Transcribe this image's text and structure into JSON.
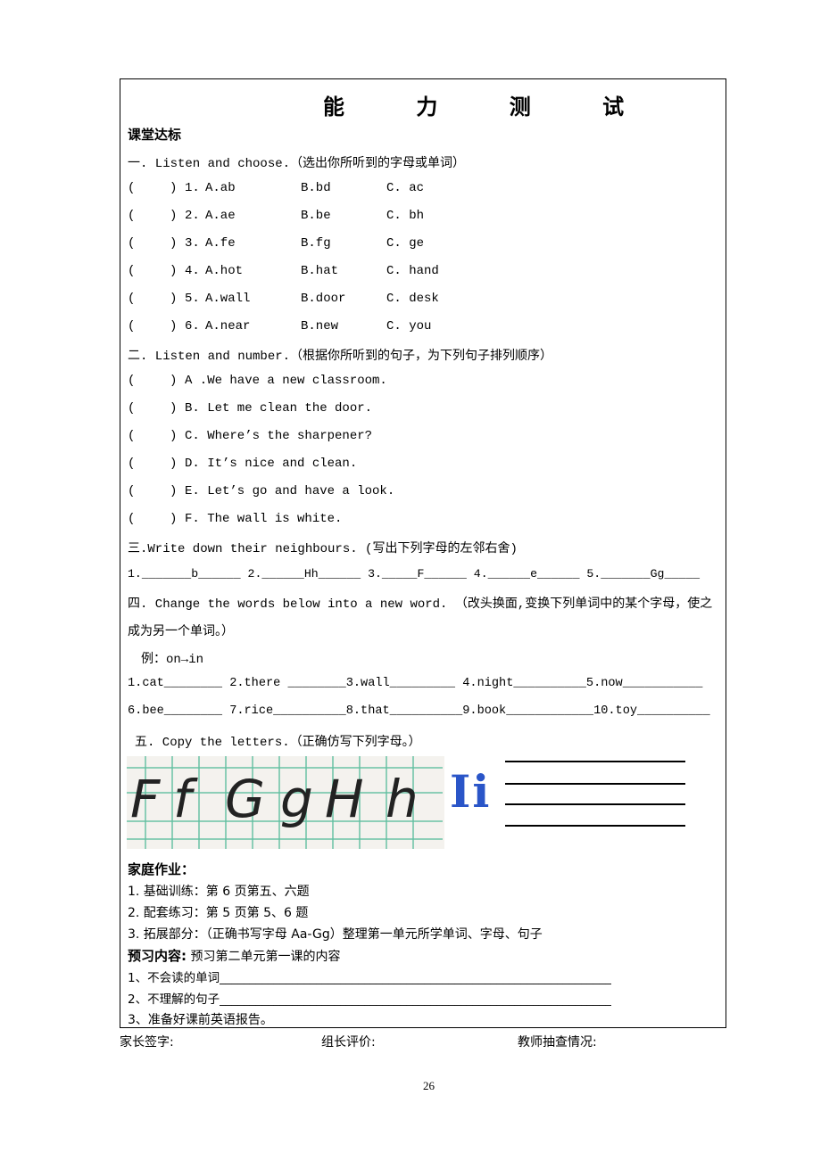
{
  "title": "能 力 测 试",
  "section_class": "课堂达标",
  "q1": {
    "heading": "一. Listen and choose.（选出你所听到的字母或单词）",
    "items": [
      {
        "num": "1.",
        "a": "A.ab",
        "b": "B.bd",
        "c": "C. ac"
      },
      {
        "num": "2.",
        "a": "A.ae",
        "b": "B.be",
        "c": "C. bh"
      },
      {
        "num": "3.",
        "a": "A.fe",
        "b": "B.fg",
        "c": "C. ge"
      },
      {
        "num": "4.",
        "a": "A.hot",
        "b": "B.hat",
        "c": "C. hand"
      },
      {
        "num": "5.",
        "a": "A.wall",
        "b": "B.door",
        "c": "C. desk"
      },
      {
        "num": "6.",
        "a": "A.near",
        "b": "B.new",
        "c": "C. you"
      }
    ]
  },
  "q2": {
    "heading": "二. Listen and number.（根据你所听到的句子，为下列句子排列顺序）",
    "items": [
      "A .We have a new classroom.",
      "B. Let me clean the door.",
      "C. Where’s the sharpener?",
      "D. It’s nice and clean.",
      "E. Let’s go and have a look.",
      "F. The wall is white."
    ]
  },
  "q3": {
    "heading": "三.Write down their neighbours. (写出下列字母的左邻右舍)",
    "line": "1._______b______ 2.______Hh______ 3._____F______ 4.______e______   5._______Gg_____"
  },
  "q4": {
    "heading": "四. Change the words below into a new word. （改头换面,变换下列单词中的某个字母，使之",
    "heading2": "成为另一个单词。）",
    "example": "例：on→in",
    "row1": "1.cat________ 2.there ________3.wall_________ 4.night__________5.now___________",
    "row2": "6.bee________ 7.rice__________8.that__________9.book____________10.toy__________"
  },
  "q5": {
    "heading": "五. Copy the letters.（正确仿写下列字母。）",
    "letters": [
      "F",
      "f",
      "G",
      "g",
      "H",
      "h"
    ],
    "print_letters": "Ii"
  },
  "homework": {
    "heading": "家庭作业：",
    "items": [
      "1. 基础训练：第 6 页第五、六题",
      "2. 配套练习：第 5 页第 5、6 题",
      "3. 拓展部分：（正确书写字母 Aa-Gg）整理第一单元所学单词、字母、句子"
    ]
  },
  "preview": {
    "heading": "预习内容:",
    "heading_text": " 预习第二单元第一课的内容",
    "items": [
      "1、不会读的单词_________________________________________________________________",
      "2、不理解的句子_________________________________________________________________",
      "3、准备好课前英语报告。"
    ]
  },
  "footer": {
    "parent": "家长签字:",
    "leader": "组长评价:",
    "teacher": "教师抽查情况:"
  },
  "page_number": "26",
  "colors": {
    "grid": "#5fbfa0",
    "print_letter": "#2a55c8"
  }
}
